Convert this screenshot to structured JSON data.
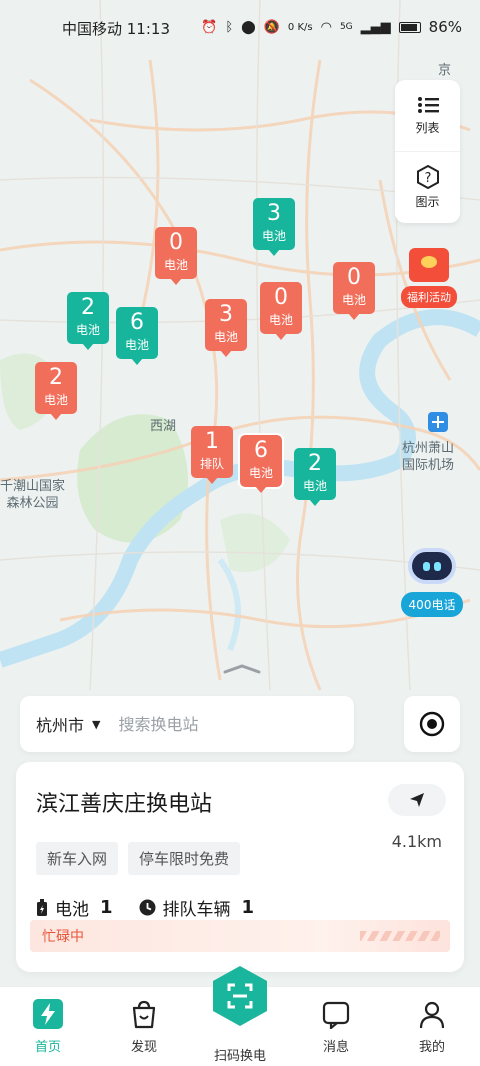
{
  "status_bar": {
    "carrier_time": "中国移动 11:13",
    "net_speed": "0 K/s",
    "network": "5G",
    "battery": "86%"
  },
  "map": {
    "labels": {
      "west_lake": "西湖",
      "airport": "杭州萧山\n国际机场",
      "forest_park": "千潮山国家\n森林公园",
      "jing": "京"
    },
    "pins": [
      {
        "num": "0",
        "label": "电池",
        "color": "red"
      },
      {
        "num": "3",
        "label": "电池",
        "color": "green"
      },
      {
        "num": "0",
        "label": "电池",
        "color": "red"
      },
      {
        "num": "2",
        "label": "电池",
        "color": "green"
      },
      {
        "num": "6",
        "label": "电池",
        "color": "green"
      },
      {
        "num": "3",
        "label": "电池",
        "color": "red"
      },
      {
        "num": "0",
        "label": "电池",
        "color": "red"
      },
      {
        "num": "2",
        "label": "电池",
        "color": "red"
      },
      {
        "num": "1",
        "label": "排队",
        "color": "red"
      },
      {
        "num": "6",
        "label": "电池",
        "color": "red"
      },
      {
        "num": "2",
        "label": "电池",
        "color": "green"
      }
    ]
  },
  "side_panel": {
    "list_label": "列表",
    "legend_label": "图示"
  },
  "welfare": {
    "label": "福利活动"
  },
  "hotline": {
    "label": "400电话"
  },
  "search": {
    "city": "杭州市",
    "placeholder": "搜索换电站"
  },
  "station": {
    "name": "滨江善庆庄换电站",
    "distance": "4.1km",
    "tags": [
      "新车入网",
      "停车限时免费"
    ],
    "battery_label": "电池",
    "battery_count": "1",
    "queue_label": "排队车辆",
    "queue_count": "1",
    "status": "忙碌中"
  },
  "tabs": [
    {
      "label": "首页"
    },
    {
      "label": "发现"
    },
    {
      "label": "扫码换电"
    },
    {
      "label": "消息"
    },
    {
      "label": "我的"
    }
  ],
  "colors": {
    "accent": "#19b59c",
    "pin_red": "#f06e5a",
    "pin_green": "#17b59c",
    "busy": "#e8563b"
  }
}
